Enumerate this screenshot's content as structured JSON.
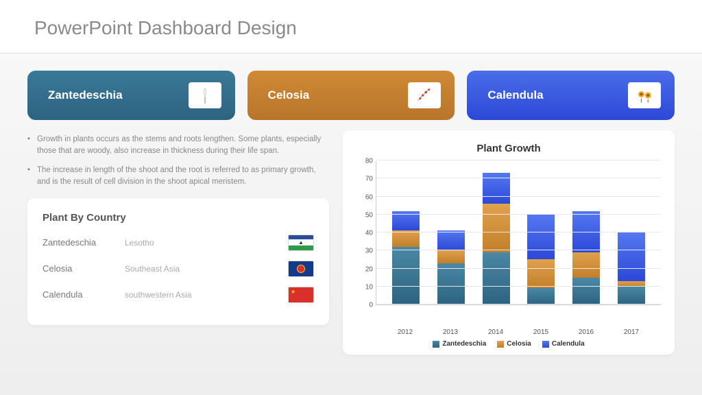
{
  "header": {
    "title": "PowerPoint Dashboard Design"
  },
  "cards": [
    {
      "label": "Zantedeschia",
      "icon": "flower-zantedeschia"
    },
    {
      "label": "Celosia",
      "icon": "flower-celosia"
    },
    {
      "label": "Calendula",
      "icon": "flower-calendula"
    }
  ],
  "bullets": [
    "Growth in plants occurs as the stems and roots lengthen. Some plants, especially those that are woody, also increase in thickness during their life span.",
    "The increase in length of the shoot and the root is referred to as primary growth, and is the result of cell division in the shoot apical meristem."
  ],
  "country_panel": {
    "title": "Plant By Country",
    "rows": [
      {
        "plant": "Zantedeschia",
        "region": "Lesotho",
        "flag": "lesotho"
      },
      {
        "plant": "Celosia",
        "region": "Southeast Asia",
        "flag": "asean"
      },
      {
        "plant": "Calendula",
        "region": "southwestern Asia",
        "flag": "china"
      }
    ]
  },
  "chart_data": {
    "type": "bar",
    "stacked": true,
    "title": "Plant Growth",
    "xlabel": "",
    "ylabel": "",
    "ylim": [
      0,
      80
    ],
    "yticks": [
      0,
      10,
      20,
      30,
      40,
      50,
      60,
      70,
      80
    ],
    "categories": [
      "2012",
      "2013",
      "2014",
      "2015",
      "2016",
      "2017"
    ],
    "series": [
      {
        "name": "Zantedeschia",
        "color": "#2d6380",
        "values": [
          32,
          23,
          29,
          9,
          15,
          10
        ]
      },
      {
        "name": "Celosia",
        "color": "#c27f2a",
        "values": [
          9,
          7,
          27,
          16,
          14,
          3
        ]
      },
      {
        "name": "Calendula",
        "color": "#2c48d8",
        "values": [
          11,
          11,
          17,
          25,
          23,
          27
        ]
      }
    ],
    "legend_position": "bottom",
    "grid": true
  }
}
